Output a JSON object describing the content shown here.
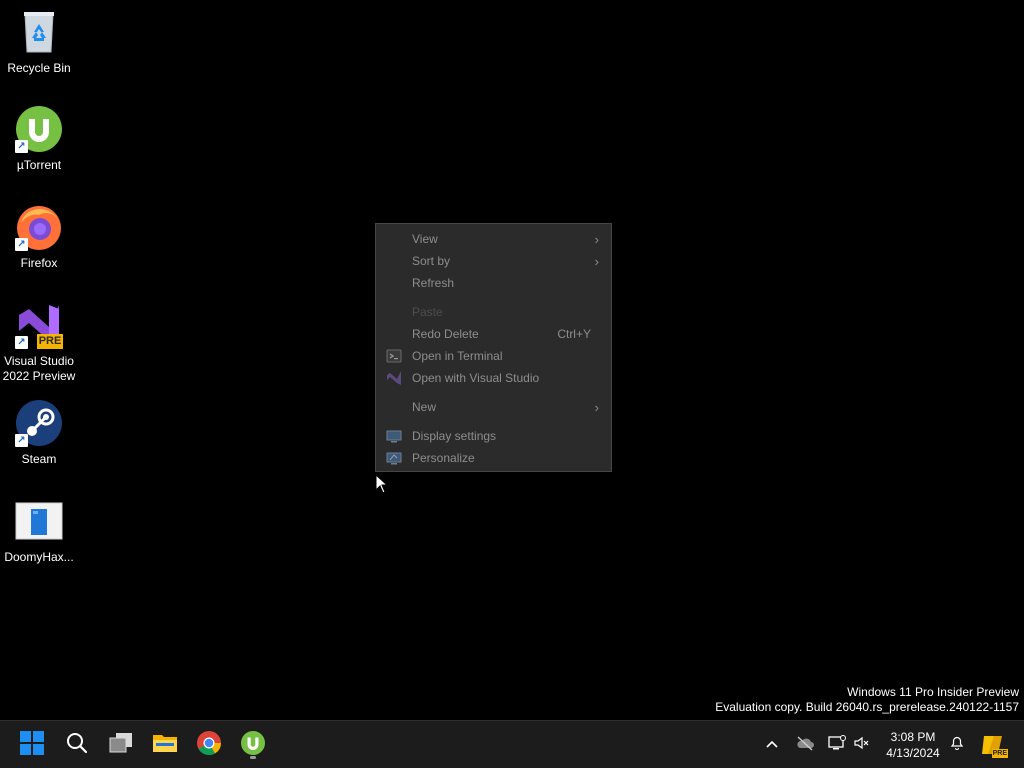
{
  "desktop": {
    "icons": [
      {
        "label": "Recycle Bin",
        "icon": "recycle-bin-icon"
      },
      {
        "label": "µTorrent",
        "icon": "utorrent-icon"
      },
      {
        "label": "Firefox",
        "icon": "firefox-icon"
      },
      {
        "label": "Visual Studio 2022 Preview",
        "icon": "visual-studio-preview-icon",
        "badge": "PRE"
      },
      {
        "label": "Steam",
        "icon": "steam-icon"
      },
      {
        "label": "DoomyHax...",
        "icon": "document-icon"
      }
    ]
  },
  "context_menu": {
    "items": [
      {
        "label": "View",
        "has_submenu": true
      },
      {
        "label": "Sort by",
        "has_submenu": true
      },
      {
        "label": "Refresh"
      },
      {
        "label": "Paste",
        "disabled": true
      },
      {
        "label": "Redo Delete",
        "shortcut": "Ctrl+Y"
      },
      {
        "label": "Open in Terminal",
        "icon": "terminal-icon"
      },
      {
        "label": "Open with Visual Studio",
        "icon": "visual-studio-icon"
      },
      {
        "label": "New",
        "has_submenu": true
      },
      {
        "label": "Display settings",
        "icon": "display-icon"
      },
      {
        "label": "Personalize",
        "icon": "personalize-icon"
      }
    ]
  },
  "watermark": {
    "line1": "Windows 11 Pro Insider Preview",
    "line2": "Evaluation copy. Build 26040.rs_prerelease.240122-1157"
  },
  "taskbar": {
    "apps": [
      "start-icon",
      "search-icon",
      "task-view-icon",
      "file-explorer-icon",
      "chrome-icon",
      "utorrent-icon"
    ],
    "tray": [
      "chevron-up-icon",
      "onedrive-offline-icon",
      "network-icon",
      "volume-muted-icon"
    ],
    "time": "3:08 PM",
    "date": "4/13/2024",
    "preview_badge": "PRE"
  },
  "colors": {
    "menu_bg": "#2b2b2b",
    "menu_text": "#8d8d8d",
    "taskbar_bg": "#1c1c1c",
    "accent": "#1f8ef1"
  }
}
